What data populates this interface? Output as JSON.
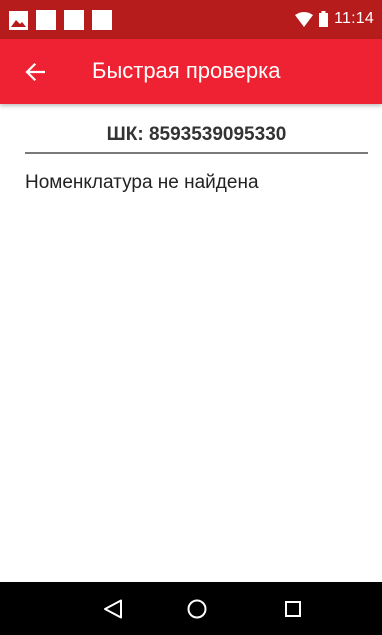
{
  "status_bar": {
    "time": "11:14",
    "background_color": "#b71c1c",
    "icons_left": [
      "image-notification-icon",
      "notification-square-icon",
      "notification-square-icon",
      "notification-square-icon"
    ],
    "icons_right": [
      "wifi-icon",
      "battery-icon"
    ]
  },
  "app_bar": {
    "title": "Быстрая проверка",
    "back_icon": "arrow-back-icon",
    "background_color": "#ee2232"
  },
  "barcode": {
    "text": "ШК: 8593539095330"
  },
  "message": {
    "text": "Номенклатура не найдена"
  },
  "nav_bar": {
    "buttons": [
      "back-triangle-icon",
      "home-circle-icon",
      "recents-square-icon"
    ]
  }
}
